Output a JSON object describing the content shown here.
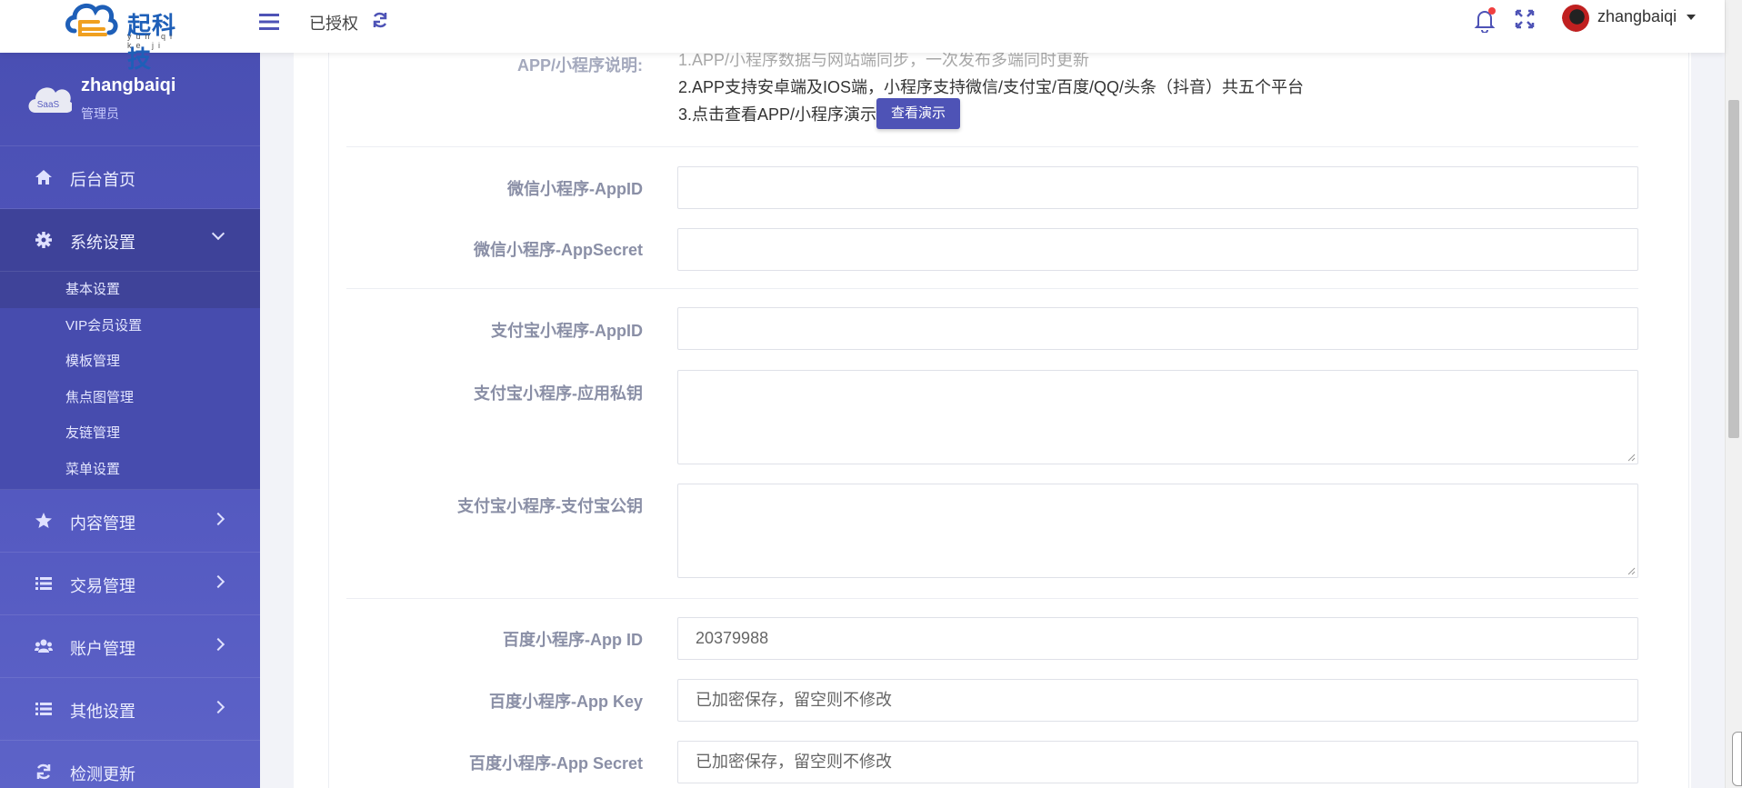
{
  "header": {
    "brand": "起科技",
    "brand_pinyin": "yun qi ke ji",
    "auth_status": "已授权",
    "username": "zhangbaiqi"
  },
  "sidebar": {
    "avatar_text": "SaaS",
    "profile_name": "zhangbaiqi",
    "profile_role": "管理员",
    "items": [
      {
        "label": "后台首页",
        "icon": "home-icon"
      },
      {
        "label": "系统设置",
        "icon": "gear-icon",
        "expanded": true
      },
      {
        "label": "内容管理",
        "icon": "star-icon"
      },
      {
        "label": "交易管理",
        "icon": "list-icon"
      },
      {
        "label": "账户管理",
        "icon": "users-icon"
      },
      {
        "label": "其他设置",
        "icon": "list-icon"
      },
      {
        "label": "检测更新",
        "icon": "refresh-icon"
      }
    ],
    "submenu": [
      {
        "label": "基本设置",
        "active": true
      },
      {
        "label": "VIP会员设置"
      },
      {
        "label": "模板管理"
      },
      {
        "label": "焦点图管理"
      },
      {
        "label": "友链管理"
      },
      {
        "label": "菜单设置"
      }
    ]
  },
  "form": {
    "app_desc_label": "APP/小程序说明:",
    "app_desc_lines": [
      "1.APP/小程序数据与网站端同步，一次发布多端同时更新",
      "2.APP支持安卓端及IOS端，小程序支持微信/支付宝/百度/QQ/头条（抖音）共五个平台",
      "3.点击查看APP/小程序演示"
    ],
    "demo_button": "查看演示",
    "fields": {
      "wx_appid": {
        "label": "微信小程序-AppID",
        "value": ""
      },
      "wx_secret": {
        "label": "微信小程序-AppSecret",
        "value": ""
      },
      "ali_appid": {
        "label": "支付宝小程序-AppID",
        "value": ""
      },
      "ali_private_key": {
        "label": "支付宝小程序-应用私钥",
        "value": ""
      },
      "ali_public_key": {
        "label": "支付宝小程序-支付宝公钥",
        "value": ""
      },
      "bd_appid": {
        "label": "百度小程序-App ID",
        "value": "20379988"
      },
      "bd_appkey": {
        "label": "百度小程序-App Key",
        "placeholder": "已加密保存，留空则不修改"
      },
      "bd_secret": {
        "label": "百度小程序-App Secret",
        "placeholder": "已加密保存，留空则不修改"
      }
    }
  }
}
